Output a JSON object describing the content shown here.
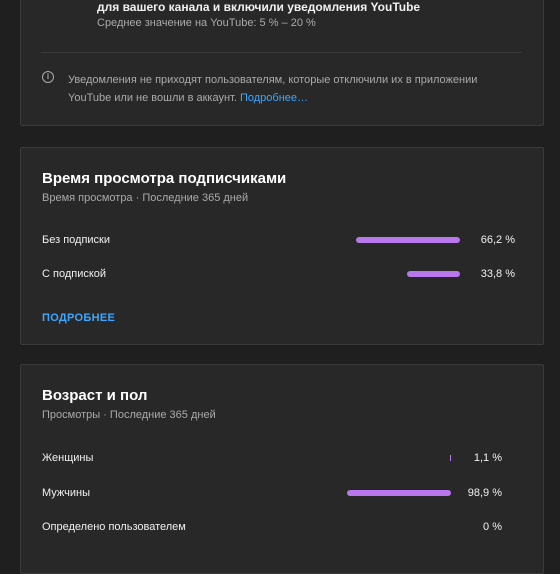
{
  "notifications_card": {
    "line1": "для вашего канала и включили уведомления YouTube",
    "line2": "Среднее значение на YouTube: 5 % – 20 %",
    "info_icon": "info-icon",
    "info_text": "Уведомления не приходят пользователям, которые отключили их в приложении YouTube или не вошли в аккаунт.",
    "info_link": "Подробнее…"
  },
  "subscribers_card": {
    "title": "Время просмотра подписчиками",
    "subtitle": "Время просмотра · Последние 365 дней",
    "rows": [
      {
        "label": "Без подписки",
        "value": "66,2 %",
        "fraction": 0.662
      },
      {
        "label": "С подпиской",
        "value": "33,8 %",
        "fraction": 0.338
      }
    ],
    "more_label": "ПОДРОБНЕЕ"
  },
  "age_gender_card": {
    "title": "Возраст и пол",
    "subtitle": "Просмотры · Последние 365 дней",
    "rows": [
      {
        "label": "Женщины",
        "value": "1,1 %",
        "fraction": 0.011
      },
      {
        "label": "Мужчины",
        "value": "98,9 %",
        "fraction": 0.989
      },
      {
        "label": "Определено пользователем",
        "value": "0 %",
        "fraction": 0
      }
    ]
  },
  "colors": {
    "background": "#1f1f1f",
    "card": "#282828",
    "bar": "#b877ec",
    "link": "#3ea6ff"
  }
}
